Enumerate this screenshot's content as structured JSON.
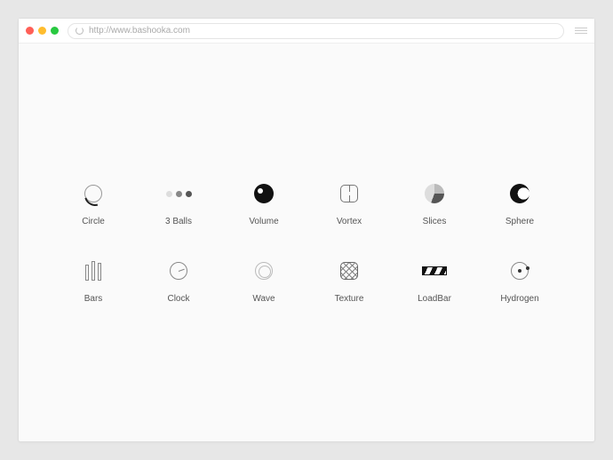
{
  "browser": {
    "url": "http://www.bashooka.com"
  },
  "items": [
    {
      "label": "Circle",
      "icon": "circle-icon"
    },
    {
      "label": "3 Balls",
      "icon": "three-balls-icon"
    },
    {
      "label": "Volume",
      "icon": "volume-icon"
    },
    {
      "label": "Vortex",
      "icon": "vortex-icon"
    },
    {
      "label": "Slices",
      "icon": "slices-icon"
    },
    {
      "label": "Sphere",
      "icon": "sphere-icon"
    },
    {
      "label": "Bars",
      "icon": "bars-icon"
    },
    {
      "label": "Clock",
      "icon": "clock-icon"
    },
    {
      "label": "Wave",
      "icon": "wave-icon"
    },
    {
      "label": "Texture",
      "icon": "texture-icon"
    },
    {
      "label": "LoadBar",
      "icon": "loadbar-icon"
    },
    {
      "label": "Hydrogen",
      "icon": "hydrogen-icon"
    }
  ]
}
